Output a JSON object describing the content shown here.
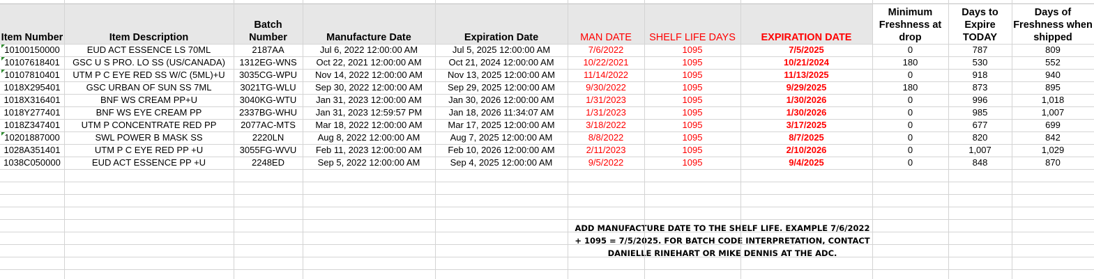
{
  "columns": [
    {
      "key": "item_number",
      "label": "Item Number"
    },
    {
      "key": "item_description",
      "label": "Item Description"
    },
    {
      "key": "batch_number",
      "label": "Batch Number"
    },
    {
      "key": "manufacture_date",
      "label": "Manufacture Date"
    },
    {
      "key": "expiration_date",
      "label": "Expiration Date"
    },
    {
      "key": "man_date",
      "label": "MAN DATE"
    },
    {
      "key": "shelf_life_days",
      "label": "SHELF LIFE DAYS"
    },
    {
      "key": "expiration_date_calc",
      "label": "EXPIRATION DATE"
    },
    {
      "key": "min_freshness",
      "label": "Minimum Freshness at drop"
    },
    {
      "key": "days_to_expire",
      "label": "Days to Expire TODAY"
    },
    {
      "key": "days_freshness",
      "label": "Days of Freshness when shipped"
    }
  ],
  "rows": [
    [
      "10100150000",
      "EUD ACT ESSENCE LS 70ML",
      "2187AA",
      "Jul 6, 2022 12:00:00 AM",
      "Jul 5, 2025 12:00:00 AM",
      "7/6/2022",
      "1095",
      "7/5/2025",
      "0",
      "787",
      "809"
    ],
    [
      "10107618401",
      "GSC U S PRO. LO SS (US/CANADA)",
      "1312EG-WNS",
      "Oct 22, 2021 12:00:00 AM",
      "Oct 21, 2024 12:00:00 AM",
      "10/22/2021",
      "1095",
      "10/21/2024",
      "180",
      "530",
      "552"
    ],
    [
      "10107810401",
      "UTM P C EYE RED SS W/C (5ML)+U",
      "3035CG-WPU",
      "Nov 14, 2022 12:00:00 AM",
      "Nov 13, 2025 12:00:00 AM",
      "11/14/2022",
      "1095",
      "11/13/2025",
      "0",
      "918",
      "940"
    ],
    [
      "1018X295401",
      "GSC URBAN OF SUN SS 7ML",
      "3021TG-WLU",
      "Sep 30, 2022 12:00:00 AM",
      "Sep 29, 2025 12:00:00 AM",
      "9/30/2022",
      "1095",
      "9/29/2025",
      "180",
      "873",
      "895"
    ],
    [
      "1018X316401",
      "BNF WS CREAM PP+U",
      "3040KG-WTU",
      "Jan 31, 2023 12:00:00 AM",
      "Jan 30, 2026 12:00:00 AM",
      "1/31/2023",
      "1095",
      "1/30/2026",
      "0",
      "996",
      "1,018"
    ],
    [
      "1018Y277401",
      "BNF WS EYE CREAM PP",
      "2337BG-WHU",
      "Jan 31, 2023 12:59:57 PM",
      "Jan 18, 2026 11:34:07 AM",
      "1/31/2023",
      "1095",
      "1/30/2026",
      "0",
      "985",
      "1,007"
    ],
    [
      "1018Z347401",
      "UTM P CONCENTRATE RED PP",
      "2077AC-MTS",
      "Mar 18, 2022 12:00:00 AM",
      "Mar 17, 2025 12:00:00 AM",
      "3/18/2022",
      "1095",
      "3/17/2025",
      "0",
      "677",
      "699"
    ],
    [
      "10201887000",
      "SWL POWER B MASK SS",
      "2220LN",
      "Aug 8, 2022 12:00:00 AM",
      "Aug 7, 2025 12:00:00 AM",
      "8/8/2022",
      "1095",
      "8/7/2025",
      "0",
      "820",
      "842"
    ],
    [
      "1028A351401",
      "UTM P C EYE RED PP +U",
      "3055FG-WVU",
      "Feb 11, 2023 12:00:00 AM",
      "Feb 10, 2026 12:00:00 AM",
      "2/11/2023",
      "1095",
      "2/10/2026",
      "0",
      "1,007",
      "1,029"
    ],
    [
      "1038C050000",
      "EUD ACT ESSENCE PP +U",
      "2248ED",
      "Sep 5, 2022 12:00:00 AM",
      "Sep 4, 2025 12:00:00 AM",
      "9/5/2022",
      "1095",
      "9/4/2025",
      "0",
      "848",
      "870"
    ]
  ],
  "rows_with_indicator": [
    0,
    1,
    2,
    7
  ],
  "note": "ADD MANUFACTURE DATE TO THE SHELF LIFE.  EXAMPLE  7/6/2022 + 1095 = 7/5/2025.  FOR BATCH CODE INTERPRETATION, CONTACT DANIELLE RINEHART OR MIKE DENNIS AT THE ADC.",
  "colors": {
    "header_bg": "#e7e7e7",
    "red": "#ff0000",
    "grid": "#d4d4d4",
    "indicator": "#2e8b2e"
  }
}
